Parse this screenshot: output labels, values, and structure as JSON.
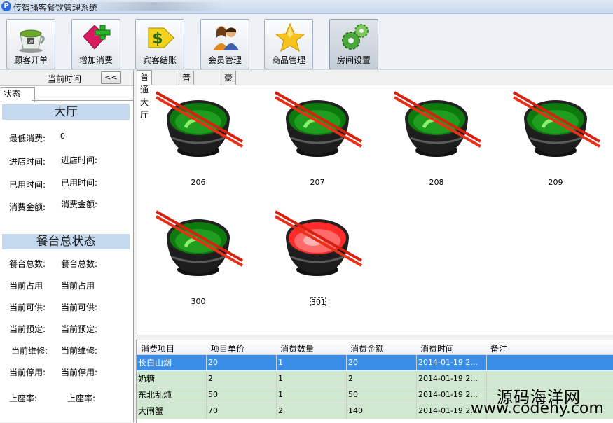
{
  "window": {
    "title": "传智播客餐饮管理系统"
  },
  "toolbar": {
    "buttons": [
      {
        "label": "顾客开单",
        "icon": "coffee-cup-icon"
      },
      {
        "label": "增加消费",
        "icon": "add-diamond-icon"
      },
      {
        "label": "宾客结账",
        "icon": "dollar-arrow-icon"
      },
      {
        "label": "会员管理",
        "icon": "members-icon"
      },
      {
        "label": "商品管理",
        "icon": "star-icon"
      },
      {
        "label": "房间设置",
        "icon": "gears-icon"
      }
    ]
  },
  "left_panel": {
    "current_time_label": "当前时间",
    "collapse_label": "<<",
    "state_tab": "状态",
    "hall": {
      "header": "大厅",
      "min_spend_label": "最低消费:",
      "min_spend_value": "0",
      "checkin_label": "进店时间:",
      "checkin_value": "进店时间:",
      "used_label": "已用时间:",
      "used_value": "已用时间:",
      "amount_label": "消费金额:",
      "amount_value": "消费金额:"
    },
    "overall": {
      "header": "餐台总状态",
      "rows": [
        {
          "label": "餐台总数:",
          "value": "餐台总数:"
        },
        {
          "label": "当前占用",
          "value": "当前占用"
        },
        {
          "label": "当前可供:",
          "value": "当前可供:"
        },
        {
          "label": "当前预定:",
          "value": "当前预定:"
        },
        {
          "label": "当前维修:",
          "value": "当前维修:"
        },
        {
          "label": "当前停用:",
          "value": "当前停用:"
        },
        {
          "label": "上座率:",
          "value": "上座率:"
        }
      ]
    }
  },
  "room_tabs": [
    "普通大厅",
    "普通包间",
    "豪华包间"
  ],
  "tables": [
    {
      "number": "206",
      "status": "free",
      "color": "#1a8a1a"
    },
    {
      "number": "207",
      "status": "free",
      "color": "#1a8a1a"
    },
    {
      "number": "208",
      "status": "free",
      "color": "#1a8a1a"
    },
    {
      "number": "209",
      "status": "free",
      "color": "#1a8a1a"
    },
    {
      "number": "300",
      "status": "free",
      "color": "#1a8a1a"
    },
    {
      "number": "301",
      "status": "occupied",
      "color": "#e01010"
    }
  ],
  "consumption": {
    "columns": [
      "消费项目",
      "项目单价",
      "消费数量",
      "消费金额",
      "消费时间",
      "备注"
    ],
    "rows": [
      {
        "item": "长白山烟",
        "price": "20",
        "qty": "1",
        "amount": "20",
        "time": "2014-01-19 2...",
        "note": "",
        "selected": true
      },
      {
        "item": "奶糖",
        "price": "2",
        "qty": "1",
        "amount": "2",
        "time": "2014-01-19 2...",
        "note": "",
        "selected": false
      },
      {
        "item": "东北乱炖",
        "price": "50",
        "qty": "1",
        "amount": "50",
        "time": "2014-01-19 2...",
        "note": "",
        "selected": false
      },
      {
        "item": "大闸蟹",
        "price": "70",
        "qty": "2",
        "amount": "140",
        "time": "2014-01-19 2...",
        "note": "",
        "selected": false
      }
    ]
  },
  "watermark": {
    "line1": "源码海洋网",
    "line2": "www.codehy.com"
  }
}
